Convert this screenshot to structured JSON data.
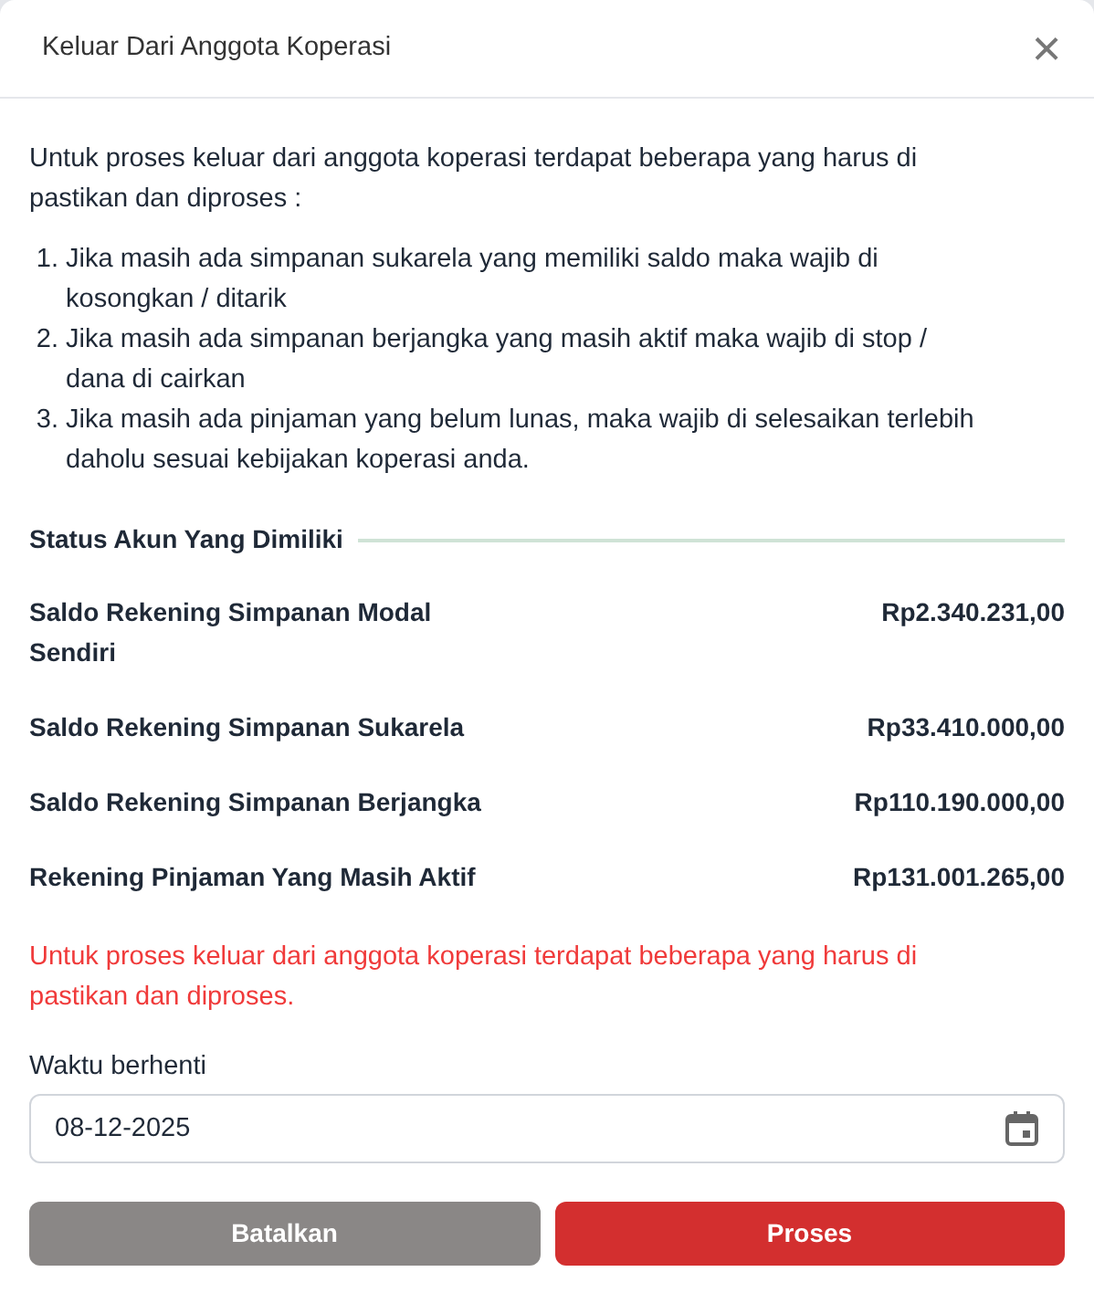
{
  "dialog": {
    "title": "Keluar Dari Anggota Koperasi",
    "close": "×"
  },
  "intro": "Untuk proses keluar dari anggota koperasi terdapat beberapa yang harus di pastikan dan diproses :",
  "steps": [
    {
      "number": "1.",
      "text": "Jika masih ada simpanan sukarela yang memiliki saldo maka wajib di kosongkan / ditarik"
    },
    {
      "number": "2.",
      "text": "Jika masih ada simpanan berjangka yang masih aktif maka wajib di stop / dana di cairkan"
    },
    {
      "number": "3.",
      "text": "Jika masih ada pinjaman yang belum lunas, maka wajib di selesaikan terlebih daholu sesuai kebijakan koperasi anda."
    }
  ],
  "status_section": {
    "title": "Status Akun Yang Dimiliki",
    "accounts": [
      {
        "label": "Saldo Rekening Simpanan Modal Sendiri",
        "amount": "Rp2.340.231,00"
      },
      {
        "label": "Saldo Rekening Simpanan Sukarela",
        "amount": "Rp33.410.000,00"
      },
      {
        "label": "Saldo Rekening Simpanan Berjangka",
        "amount": "Rp110.190.000,00"
      },
      {
        "label": "Rekening Pinjaman Yang Masih Aktif",
        "amount": "Rp131.001.265,00"
      }
    ]
  },
  "warning": "Untuk proses keluar dari anggota koperasi terdapat beberapa yang harus di pastikan dan diproses.",
  "stop_date": {
    "label": "Waktu berhenti",
    "value": "08-12-2025"
  },
  "buttons": [
    {
      "label": "Batalkan",
      "kind": "cancel"
    },
    {
      "label": "Proses",
      "kind": "primary"
    }
  ]
}
